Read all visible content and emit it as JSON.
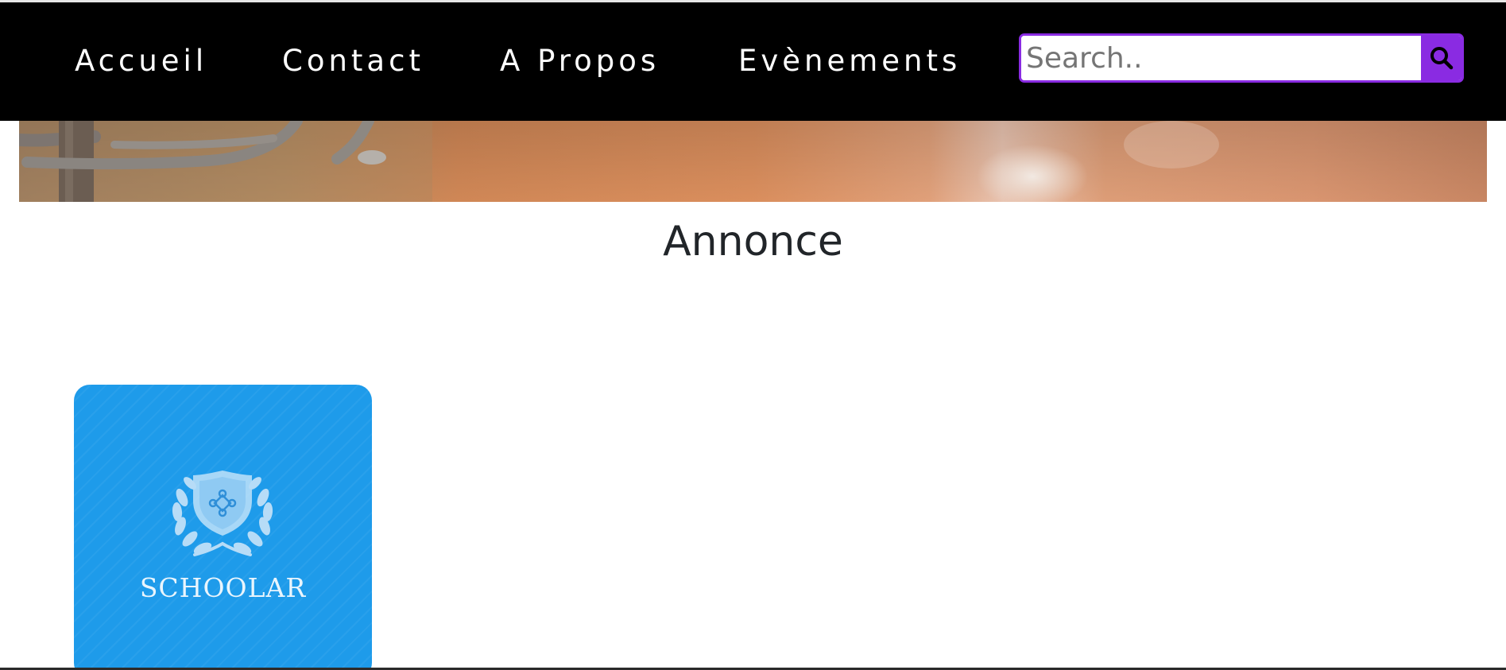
{
  "nav": {
    "links": [
      {
        "label": "Accueil"
      },
      {
        "label": "Contact"
      },
      {
        "label": "A Propos"
      },
      {
        "label": "Evènements"
      }
    ],
    "search": {
      "placeholder": "Search..",
      "value": "",
      "button_icon": "search-icon"
    }
  },
  "main": {
    "heading": "Annonce",
    "cards": [
      {
        "logo_icon": "shield-laurel-icon",
        "logo_text": "SCHOOLAR"
      }
    ]
  },
  "colors": {
    "navbar_bg": "#000000",
    "nav_text": "#ffffff",
    "search_accent": "#8a2be2",
    "card_bg": "#1e9bea",
    "heading_text": "#212529"
  }
}
